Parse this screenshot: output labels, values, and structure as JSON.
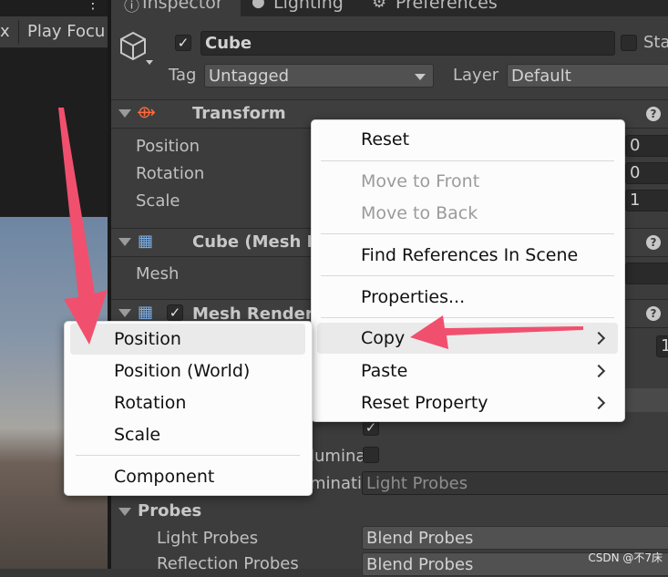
{
  "tabs": {
    "inspector": "Inspector",
    "lighting": "Lighting",
    "preferences": "Preferences"
  },
  "left_toolbar": {
    "x_fragment": "x",
    "play_focus": "Play Focu"
  },
  "object": {
    "name": "Cube",
    "active": true,
    "static_fragment": "Sta",
    "tag_label": "Tag",
    "tag_value": "Untagged",
    "layer_label": "Layer",
    "layer_value": "Default"
  },
  "transform": {
    "title": "Transform",
    "rows": [
      {
        "label": "Position",
        "value": "0"
      },
      {
        "label": "Rotation",
        "value": "0"
      },
      {
        "label": "Scale",
        "value": "1"
      }
    ]
  },
  "mesh_filter": {
    "title": "Cube (Mesh F",
    "mesh_label": "Mesh"
  },
  "mesh_renderer": {
    "title": "Mesh Rendere",
    "row_value_fragment": "1"
  },
  "lighting_section": {
    "illum_fragment": "lumina",
    "probes_fragment": "minati",
    "probes_value": "Light Probes"
  },
  "probes": {
    "title": "Probes",
    "light_label": "Light Probes",
    "light_value": "Blend Probes",
    "reflection_label": "Reflection Probes",
    "reflection_value": "Blend Probes"
  },
  "context_menu": {
    "reset": "Reset",
    "move_front": "Move to Front",
    "move_back": "Move to Back",
    "find_refs": "Find References In Scene",
    "properties": "Properties...",
    "copy": "Copy",
    "paste": "Paste",
    "reset_property": "Reset Property"
  },
  "copy_submenu": {
    "position": "Position",
    "position_world": "Position (World)",
    "rotation": "Rotation",
    "scale": "Scale",
    "component": "Component"
  },
  "watermark": "CSDN @不7床",
  "colors": {
    "arrow": "#f0506e",
    "menu_bg": "#fcfcfc",
    "panel_bg": "#3c3c3c"
  }
}
